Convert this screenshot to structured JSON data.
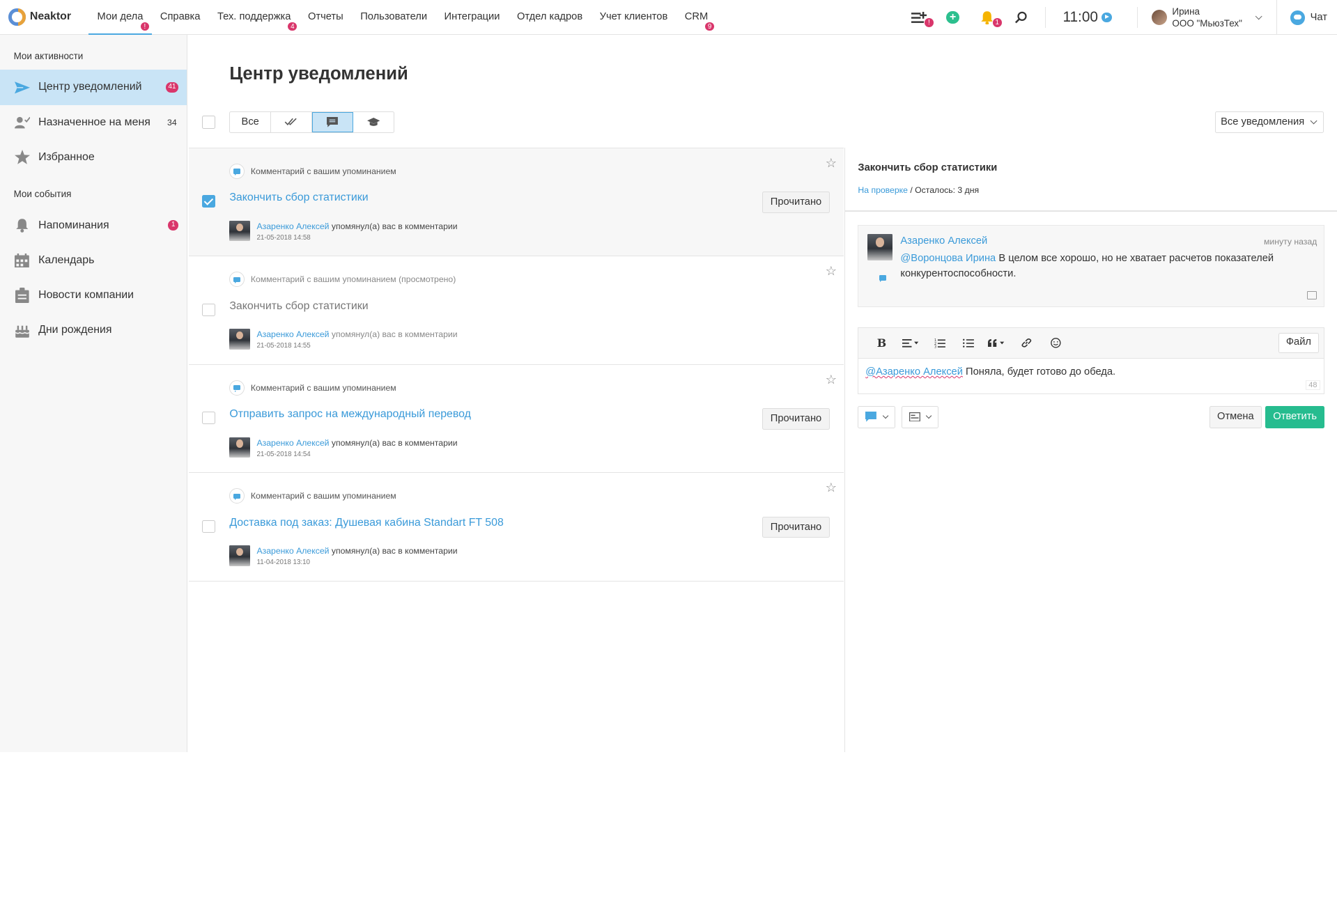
{
  "app": {
    "name": "Neaktor"
  },
  "nav": [
    {
      "label": "Мои дела",
      "badge": "!"
    },
    {
      "label": "Справка",
      "badge": ""
    },
    {
      "label": "Тех. поддержка",
      "badge": "4"
    },
    {
      "label": "Отчеты",
      "badge": ""
    },
    {
      "label": "Пользователи",
      "badge": ""
    },
    {
      "label": "Интеграции",
      "badge": ""
    },
    {
      "label": "Отдел кадров",
      "badge": ""
    },
    {
      "label": "Учет клиентов",
      "badge": ""
    },
    {
      "label": "CRM",
      "badge": "9"
    }
  ],
  "topbar": {
    "tasks_badge": "!",
    "bell_badge": "1",
    "time": "11:00",
    "user_name": "Ирина",
    "user_org": "ООО \"МьюзТех\"",
    "chat_label": "Чат",
    "colors": {
      "accent": "#4aa8e0",
      "badge": "#d9366b",
      "add": "#2cbf8e",
      "bell": "#f5b400"
    }
  },
  "sidebar": {
    "section1": "Мои активности",
    "section2": "Мои события",
    "items": [
      {
        "label": "Центр уведомлений",
        "badge": "41",
        "icon": "paper-plane-icon"
      },
      {
        "label": "Назначенное на меня",
        "count": "34",
        "icon": "user-check-icon"
      },
      {
        "label": "Избранное",
        "icon": "star-icon"
      },
      {
        "label": "Напоминания",
        "badge": "1",
        "icon": "bell-icon"
      },
      {
        "label": "Календарь",
        "icon": "calendar-icon"
      },
      {
        "label": "Новости компании",
        "icon": "news-icon"
      },
      {
        "label": "Дни рождения",
        "icon": "cake-icon"
      }
    ]
  },
  "main": {
    "title": "Центр уведомлений",
    "filter_all": "Все",
    "filter_dropdown": "Все уведомления"
  },
  "notifications": [
    {
      "type": "Комментарий с вашим упоминанием",
      "title": "Закончить сбор статистики",
      "author": "Азаренко Алексей",
      "action": "упомянул(а) вас в комментарии",
      "date": "21-05-2018 14:58",
      "button": "Прочитано",
      "checked": true
    },
    {
      "type": "Комментарий с вашим упоминанием (просмотрено)",
      "title": "Закончить сбор статистики",
      "author": "Азаренко Алексей",
      "action": "упомянул(а) вас в комментарии",
      "date": "21-05-2018 14:55",
      "checked": false
    },
    {
      "type": "Комментарий с вашим упоминанием",
      "title": "Отправить запрос на международный перевод",
      "author": "Азаренко Алексей",
      "action": "упомянул(а) вас в комментарии",
      "date": "21-05-2018 14:54",
      "button": "Прочитано",
      "checked": false
    },
    {
      "type": "Комментарий с вашим упоминанием",
      "title": "Доставка под заказ: Душевая кабина Standart FT 508",
      "author": "Азаренко Алексей",
      "action": "упомянул(а) вас в комментарии",
      "date": "11-04-2018 13:10",
      "button": "Прочитано",
      "checked": false
    }
  ],
  "detail": {
    "title": "Закончить сбор статистики",
    "status": "На проверке",
    "remaining": "Осталось: 3 дня",
    "comment": {
      "author": "Азаренко Алексей",
      "time": "минуту назад",
      "mention": "@Воронцова Ирина",
      "text": "В целом все хорошо, но не хватает расчетов показателей конкурентоспособности."
    },
    "editor": {
      "file_label": "Файл",
      "mention": "@Азаренко Алексей",
      "text": "Поняла, будет готово до обеда.",
      "counter": "48"
    },
    "cancel_label": "Отмена",
    "reply_label": "Ответить"
  }
}
